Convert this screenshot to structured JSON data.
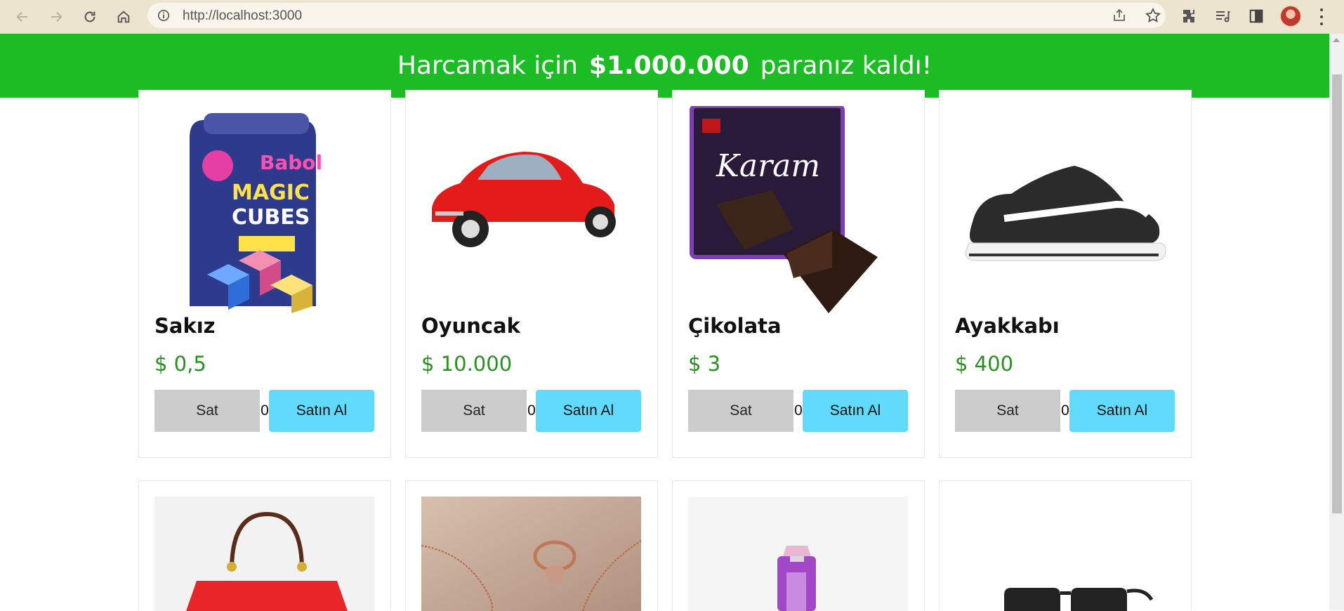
{
  "browser": {
    "url": "http://localhost:3000",
    "icons": [
      "back-icon",
      "forward-icon",
      "reload-icon",
      "home-icon",
      "info-icon",
      "share-icon",
      "star-icon",
      "extensions-icon",
      "reading-list-icon",
      "side-panel-icon",
      "profile-avatar",
      "menu-icon"
    ]
  },
  "banner": {
    "prefix": "Harcamak için",
    "amount": "$1.000.000",
    "suffix": "paranız kaldı!",
    "color": "#1bbc24"
  },
  "products": [
    {
      "name": "Sakız",
      "price": "$ 0,5",
      "qty": "0",
      "sell_label": "Sat",
      "buy_label": "Satın Al"
    },
    {
      "name": "Oyuncak",
      "price": "$ 10.000",
      "qty": "0",
      "sell_label": "Sat",
      "buy_label": "Satın Al"
    },
    {
      "name": "Çikolata",
      "price": "$ 3",
      "qty": "0",
      "sell_label": "Sat",
      "buy_label": "Satın Al"
    },
    {
      "name": "Ayakkabı",
      "price": "$ 400",
      "qty": "0",
      "sell_label": "Sat",
      "buy_label": "Satın Al"
    }
  ],
  "colors": {
    "price": "#27921f",
    "sell_button": "#cccccc",
    "buy_button": "#61dafb"
  }
}
